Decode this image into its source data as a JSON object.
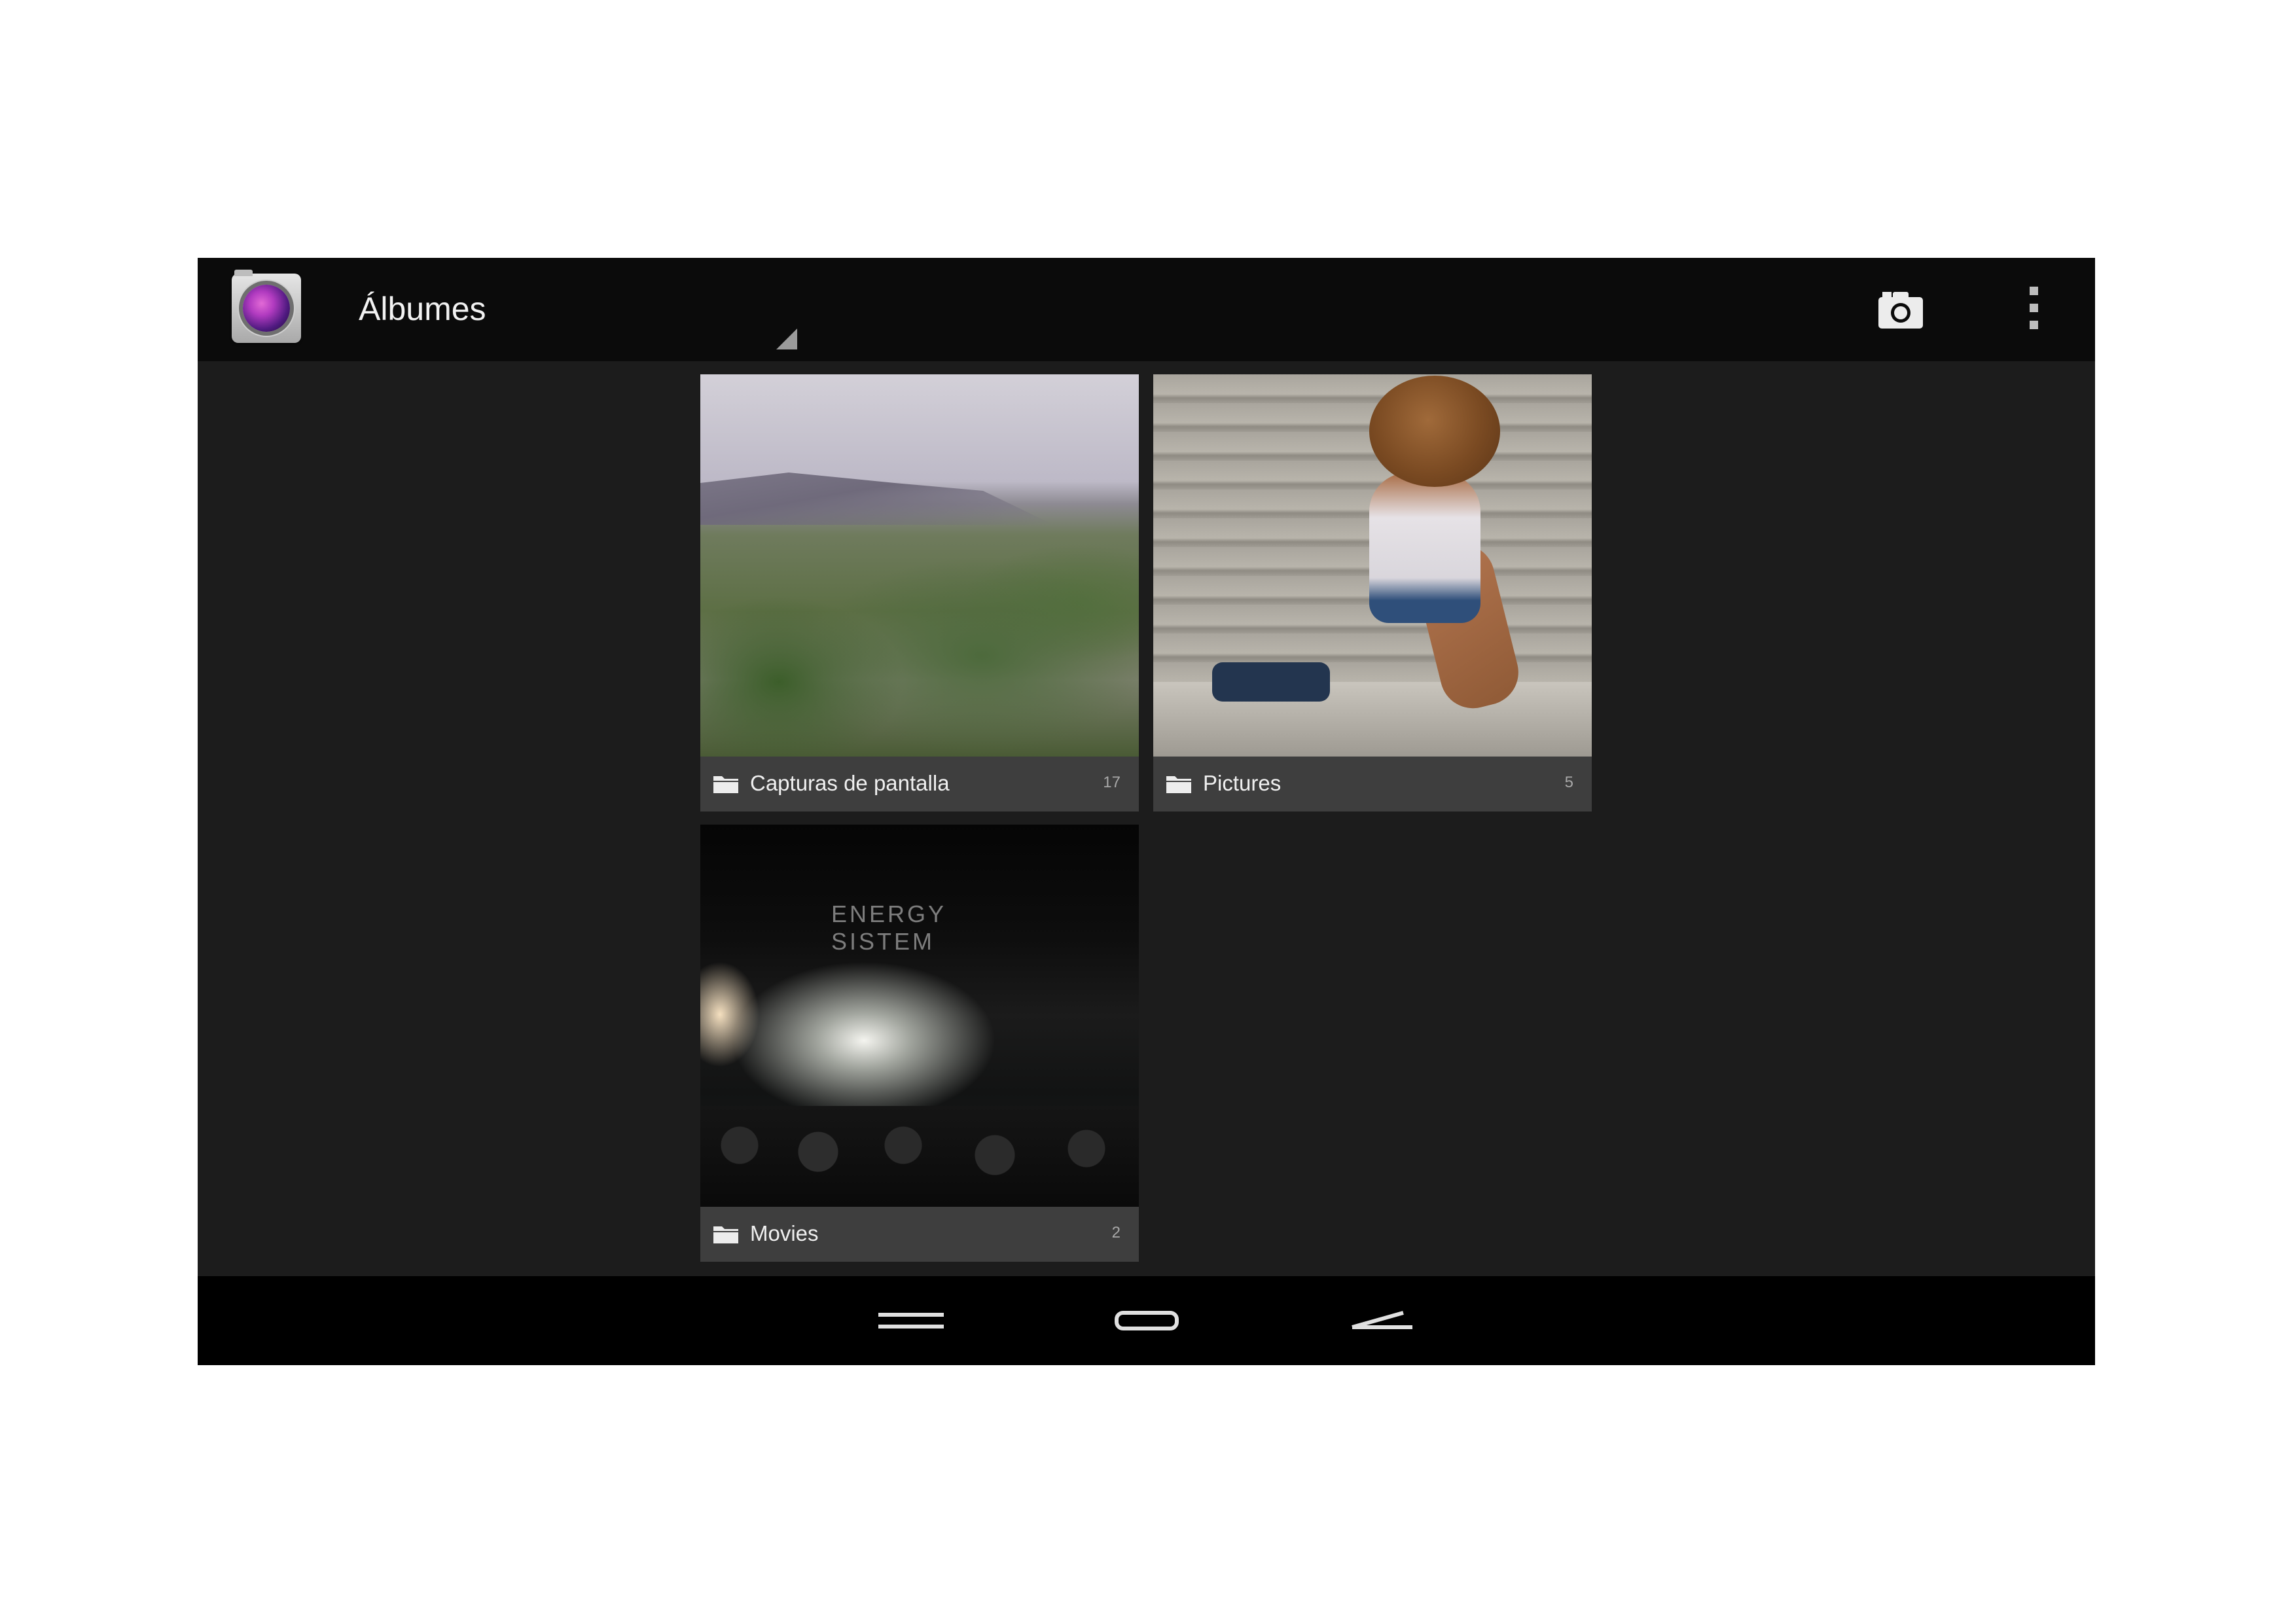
{
  "action_bar": {
    "title": "Álbumes",
    "app_icon": "gallery-camera-icon",
    "actions": [
      {
        "name": "camera",
        "icon": "camera-icon"
      },
      {
        "name": "more-options",
        "icon": "overflow-menu-icon"
      }
    ]
  },
  "albums": [
    {
      "name": "Capturas de pantalla",
      "count": "17",
      "icon": "folder-icon"
    },
    {
      "name": "Pictures",
      "count": "5",
      "icon": "folder-icon"
    },
    {
      "name": "Movies",
      "count": "2",
      "icon": "folder-icon"
    }
  ],
  "concert_photo_text": "ENERGY SISTEM",
  "navigation_bar": {
    "buttons": [
      {
        "name": "recent-apps",
        "icon": "recent-apps-icon"
      },
      {
        "name": "home",
        "icon": "home-icon"
      },
      {
        "name": "back",
        "icon": "back-icon"
      }
    ]
  },
  "colors": {
    "action_bar_bg": "#0b0b0b",
    "content_bg": "#1c1c1c",
    "label_bg": "#3e3e3e",
    "nav_bar_bg": "#000000"
  }
}
